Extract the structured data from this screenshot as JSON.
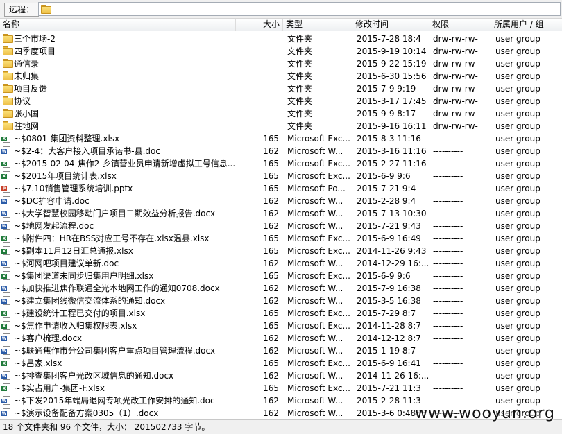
{
  "path_bar": {
    "label": "远程：",
    "value": ""
  },
  "columns": {
    "name": "名称",
    "size": "大小",
    "type": "类型",
    "modified": "修改时间",
    "permissions": "权限",
    "owner": "所属用户 / 组"
  },
  "rows": [
    {
      "kind": "folder",
      "name": "三个市场-2",
      "size": "",
      "type": "文件夹",
      "modified": "2015-7-28 18:4",
      "perm": "drw-rw-rw-",
      "owner": "user group"
    },
    {
      "kind": "folder",
      "name": "四季度项目",
      "size": "",
      "type": "文件夹",
      "modified": "2015-9-19 10:14",
      "perm": "drw-rw-rw-",
      "owner": "user group"
    },
    {
      "kind": "folder",
      "name": "通信录",
      "size": "",
      "type": "文件夹",
      "modified": "2015-9-22 15:19",
      "perm": "drw-rw-rw-",
      "owner": "user group"
    },
    {
      "kind": "folder",
      "name": "未归集",
      "size": "",
      "type": "文件夹",
      "modified": "2015-6-30 15:56",
      "perm": "drw-rw-rw-",
      "owner": "user group"
    },
    {
      "kind": "folder",
      "name": "项目反馈",
      "size": "",
      "type": "文件夹",
      "modified": "2015-7-9 9:19",
      "perm": "drw-rw-rw-",
      "owner": "user group"
    },
    {
      "kind": "folder",
      "name": "协议",
      "size": "",
      "type": "文件夹",
      "modified": "2015-3-17 17:45",
      "perm": "drw-rw-rw-",
      "owner": "user group"
    },
    {
      "kind": "folder",
      "name": "张小国",
      "size": "",
      "type": "文件夹",
      "modified": "2015-9-9 8:17",
      "perm": "drw-rw-rw-",
      "owner": "user group"
    },
    {
      "kind": "folder",
      "name": "驻地网",
      "size": "",
      "type": "文件夹",
      "modified": "2015-9-16 16:11",
      "perm": "drw-rw-rw-",
      "owner": "user group"
    },
    {
      "kind": "xls",
      "name": "~$0801-集团资料整理.xlsx",
      "size": "165",
      "type": "Microsoft Exc...",
      "modified": "2015-8-3 11:16",
      "perm": "----------",
      "owner": "user group"
    },
    {
      "kind": "doc",
      "name": "~$2-4：大客户接入项目承诺书-县.doc",
      "size": "162",
      "type": "Microsoft W...",
      "modified": "2015-3-16 11:16",
      "perm": "----------",
      "owner": "user group"
    },
    {
      "kind": "xls",
      "name": "~$2015-02-04-焦作2-乡镇营业员申请新增虚拟工号信息...",
      "size": "165",
      "type": "Microsoft Exc...",
      "modified": "2015-2-27 11:16",
      "perm": "----------",
      "owner": "user group"
    },
    {
      "kind": "xls",
      "name": "~$2015年项目统计表.xlsx",
      "size": "165",
      "type": "Microsoft Exc...",
      "modified": "2015-6-9 9:6",
      "perm": "----------",
      "owner": "user group"
    },
    {
      "kind": "ppt",
      "name": "~$7.10销售管理系统培训.pptx",
      "size": "165",
      "type": "Microsoft Po...",
      "modified": "2015-7-21 9:4",
      "perm": "----------",
      "owner": "user group"
    },
    {
      "kind": "doc",
      "name": "~$DC扩容申请.doc",
      "size": "162",
      "type": "Microsoft W...",
      "modified": "2015-2-28 9:4",
      "perm": "----------",
      "owner": "user group"
    },
    {
      "kind": "doc",
      "name": "~$大学智慧校园移动门户项目二期效益分析报告.docx",
      "size": "162",
      "type": "Microsoft W...",
      "modified": "2015-7-13 10:30",
      "perm": "----------",
      "owner": "user group"
    },
    {
      "kind": "doc",
      "name": "~$地网发起流程.doc",
      "size": "162",
      "type": "Microsoft W...",
      "modified": "2015-7-21 9:43",
      "perm": "----------",
      "owner": "user group"
    },
    {
      "kind": "xls",
      "name": "~$附件四：HR在BSS对应工号不存在.xlsx温县.xlsx",
      "size": "165",
      "type": "Microsoft Exc...",
      "modified": "2015-6-9 16:49",
      "perm": "----------",
      "owner": "user group"
    },
    {
      "kind": "xls",
      "name": "~$副本11月12日汇总通报.xlsx",
      "size": "165",
      "type": "Microsoft Exc...",
      "modified": "2014-11-26 9:43",
      "perm": "----------",
      "owner": "user group"
    },
    {
      "kind": "doc",
      "name": "~$河网吧项目建议单新.doc",
      "size": "162",
      "type": "Microsoft W...",
      "modified": "2014-12-29 16:...",
      "perm": "----------",
      "owner": "user group"
    },
    {
      "kind": "xls",
      "name": "~$集团渠道未同步归集用户明细.xlsx",
      "size": "165",
      "type": "Microsoft Exc...",
      "modified": "2015-6-9 9:6",
      "perm": "----------",
      "owner": "user group"
    },
    {
      "kind": "doc",
      "name": "~$加快推进焦作联通全光本地网工作的通知0708.docx",
      "size": "162",
      "type": "Microsoft W...",
      "modified": "2015-7-9 16:38",
      "perm": "----------",
      "owner": "user group"
    },
    {
      "kind": "doc",
      "name": "~$建立集团线微信交流体系的通知.docx",
      "size": "162",
      "type": "Microsoft W...",
      "modified": "2015-3-5 16:38",
      "perm": "----------",
      "owner": "user group"
    },
    {
      "kind": "xls",
      "name": "~$建设统计工程已交付的项目.xlsx",
      "size": "165",
      "type": "Microsoft Exc...",
      "modified": "2015-7-29 8:7",
      "perm": "----------",
      "owner": "user group"
    },
    {
      "kind": "xls",
      "name": "~$焦作申请收入归集权限表.xlsx",
      "size": "165",
      "type": "Microsoft Exc...",
      "modified": "2014-11-28 8:7",
      "perm": "----------",
      "owner": "user group"
    },
    {
      "kind": "doc",
      "name": "~$客户梳理.docx",
      "size": "162",
      "type": "Microsoft W...",
      "modified": "2014-12-12 8:7",
      "perm": "----------",
      "owner": "user group"
    },
    {
      "kind": "doc",
      "name": "~$联通焦作市分公司集团客户重点项目管理流程.docx",
      "size": "162",
      "type": "Microsoft W...",
      "modified": "2015-1-19 8:7",
      "perm": "----------",
      "owner": "user group"
    },
    {
      "kind": "xls",
      "name": "~$吕家.xlsx",
      "size": "165",
      "type": "Microsoft Exc...",
      "modified": "2015-6-9 16:41",
      "perm": "----------",
      "owner": "user group"
    },
    {
      "kind": "doc",
      "name": "~$排查集团客户光改区域信息的通知.docx",
      "size": "162",
      "type": "Microsoft W...",
      "modified": "2014-11-26 16:...",
      "perm": "----------",
      "owner": "user group"
    },
    {
      "kind": "xls",
      "name": "~$实占用户-集团-F.xlsx",
      "size": "165",
      "type": "Microsoft Exc...",
      "modified": "2015-7-21 11:3",
      "perm": "----------",
      "owner": "user group"
    },
    {
      "kind": "doc",
      "name": "~$下发2015年端局退网专项光改工作安排的通知.doc",
      "size": "162",
      "type": "Microsoft W...",
      "modified": "2015-2-28 11:3",
      "perm": "----------",
      "owner": "user group"
    },
    {
      "kind": "doc",
      "name": "~$演示设备配备方案0305（1）.docx",
      "size": "162",
      "type": "Microsoft W...",
      "modified": "2015-3-6 0:4883",
      "perm": "----------",
      "owner": "user group"
    }
  ],
  "status_text": "18 个文件夹和 96 个文件，大小： 201502733 字节。",
  "watermark": "www.wooyun.org"
}
